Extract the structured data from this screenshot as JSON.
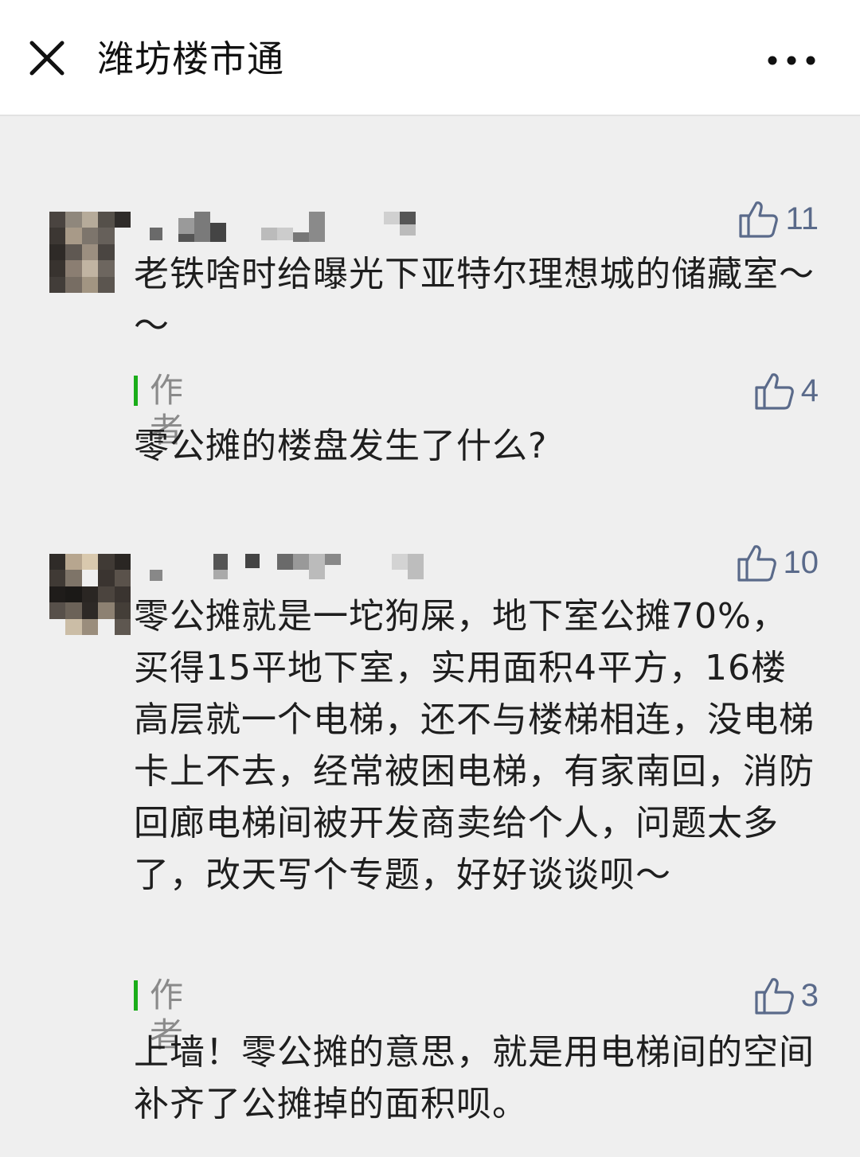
{
  "header": {
    "title": "潍坊楼市通"
  },
  "comments": [
    {
      "like_count": "11",
      "text": "老铁啥时给曝光下亚特尔理想城的储藏室～～",
      "reply": {
        "author_label": "作者",
        "like_count": "4",
        "text": "零公摊的楼盘发生了什么?"
      }
    },
    {
      "like_count": "10",
      "text": "零公摊就是一坨狗屎，地下室公摊70%，买得15平地下室，实用面积4平方，16楼高层就一个电梯，还不与楼梯相连，没电梯卡上不去，经常被困电梯，有家南回，消防回廊电梯间被开发商卖给个人，问题太多了，改天写个专题，好好谈谈呗～",
      "reply": {
        "author_label": "作者",
        "like_count": "3",
        "text": "上墙！零公摊的意思，就是用电梯间的空间补齐了公摊掉的面积呗。"
      }
    }
  ],
  "icons": {
    "close": "close-icon",
    "more": "more-icon",
    "like": "thumbs-up-icon"
  },
  "colors": {
    "background": "#efefef",
    "header_bg": "#ffffff",
    "author_bar": "#1aad19",
    "like_icon": "#5a6a8a",
    "author_label": "#8a8a8a"
  }
}
